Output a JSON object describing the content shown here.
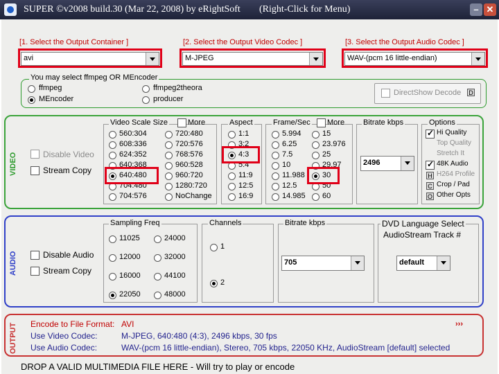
{
  "titlebar": {
    "title": "SUPER ©v2008 build.30 (Mar 22, 2008) by eRightSoft",
    "hint": "(Right-Click for Menu)"
  },
  "steps": {
    "container": {
      "label": "[1.   Select the Output Container ]",
      "value": "avi"
    },
    "video_codec": {
      "label": "[2.  Select the Output Video Codec ]",
      "value": "M-JPEG"
    },
    "audio_codec": {
      "label": "[3.  Select the Output Audio Codec ]",
      "value": "WAV-(pcm 16 little-endian)"
    }
  },
  "encoder": {
    "title": "You may select ffmpeg OR MEncoder",
    "options": [
      {
        "label": "ffmpeg",
        "selected": false
      },
      {
        "label": "ffmpeg2theora",
        "selected": false
      },
      {
        "label": "MEncoder",
        "selected": true
      },
      {
        "label": "producer",
        "selected": false
      }
    ],
    "directshow": "DirectShow Decode",
    "directshow_key": "D"
  },
  "video": {
    "panel_label": "VIDEO",
    "disable_video": "Disable Video",
    "stream_copy": "Stream Copy",
    "scale": {
      "title": "Video Scale Size",
      "more": "More",
      "col1": [
        "560:304",
        "608:336",
        "624:352",
        "640:368",
        "640:480",
        "704:480",
        "704:576"
      ],
      "col2": [
        "720:480",
        "720:576",
        "768:576",
        "960:528",
        "960:720",
        "1280:720",
        "NoChange"
      ],
      "selected": "640:480"
    },
    "aspect": {
      "title": "Aspect",
      "options": [
        "1:1",
        "3:2",
        "4:3",
        "5:4",
        "11:9",
        "12:5",
        "16:9"
      ],
      "selected": "4:3"
    },
    "frame": {
      "title": "Frame/Sec",
      "more": "More",
      "col1": [
        "5.994",
        "6.25",
        "7.5",
        "10",
        "11.988",
        "12.5",
        "14.985"
      ],
      "col2": [
        "15",
        "23.976",
        "25",
        "29.97",
        "30",
        "50",
        "60"
      ],
      "selected": "30"
    },
    "bitrate": {
      "title": "Bitrate  kbps",
      "value": "2496"
    },
    "options": {
      "title": "Options",
      "items": [
        {
          "label": "Hi Quality",
          "type": "check",
          "checked": true,
          "enabled": true
        },
        {
          "label": "Top Quality",
          "type": "plain",
          "enabled": false
        },
        {
          "label": "Stretch It",
          "type": "plain",
          "enabled": false
        },
        {
          "label": "48K Audio",
          "type": "check",
          "checked": true,
          "enabled": true
        },
        {
          "label": "H264 Profile",
          "type": "key",
          "key": "H",
          "enabled": false
        },
        {
          "label": "Crop / Pad",
          "type": "key",
          "key": "C",
          "enabled": true
        },
        {
          "label": "Other Opts",
          "type": "key",
          "key": "O",
          "enabled": true
        }
      ]
    }
  },
  "audio": {
    "panel_label": "AUDIO",
    "disable_audio": "Disable Audio",
    "stream_copy": "Stream Copy",
    "sampling": {
      "title": "Sampling Freq",
      "col1": [
        "11025",
        "12000",
        "16000",
        "22050"
      ],
      "col2": [
        "24000",
        "32000",
        "44100",
        "48000"
      ],
      "selected": "22050"
    },
    "channels": {
      "title": "Channels",
      "options": [
        "1",
        "2"
      ],
      "selected": "2"
    },
    "bitrate": {
      "title": "Bitrate  kbps",
      "value": "705"
    },
    "dvd": {
      "title_line1": "DVD Language Select",
      "title_line2": "AudioStream  Track #",
      "value": "default"
    }
  },
  "output": {
    "panel_label": "OUTPUT",
    "arrows": "›››",
    "rows": [
      {
        "label": "Encode to File Format:",
        "value": "AVI"
      },
      {
        "label": "Use Video Codec:",
        "value": "M-JPEG,  640:480 (4:3),  2496 kbps,  30 fps"
      },
      {
        "label": "Use Audio Codec:",
        "value": "WAV-(pcm 16 little-endian),  Stereo,  705 kbps,  22050 KHz,  AudioStream [default] selected"
      }
    ]
  },
  "statusbar": {
    "text": "DROP A VALID MULTIMEDIA FILE HERE - Will try to play or encode"
  },
  "colors": {
    "video_panel": "#3aa33a",
    "audio_panel": "#3040c8",
    "output_panel": "#c83232",
    "highlight": "#e00018",
    "step_text": "#c00000"
  }
}
